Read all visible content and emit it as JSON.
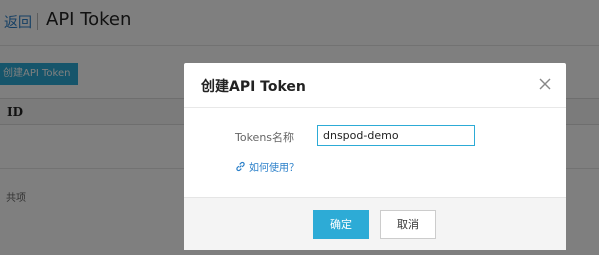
{
  "header": {
    "back_label": "返回",
    "title": "API Token"
  },
  "toolbar": {
    "create_label": "创建API Token"
  },
  "table": {
    "columns": [
      "ID"
    ],
    "footer_text": "共项"
  },
  "dialog": {
    "title": "创建API Token",
    "field_label": "Tokens名称",
    "field_value": "dnspod-demo",
    "help_link": "如何使用？",
    "confirm_label": "确定",
    "cancel_label": "取消",
    "close_icon": "close-icon",
    "help_icon": "link-icon"
  },
  "colors": {
    "accent": "#2dabd6",
    "link": "#2a7fc9",
    "overlay": "rgba(0,0,0,0.5)"
  }
}
